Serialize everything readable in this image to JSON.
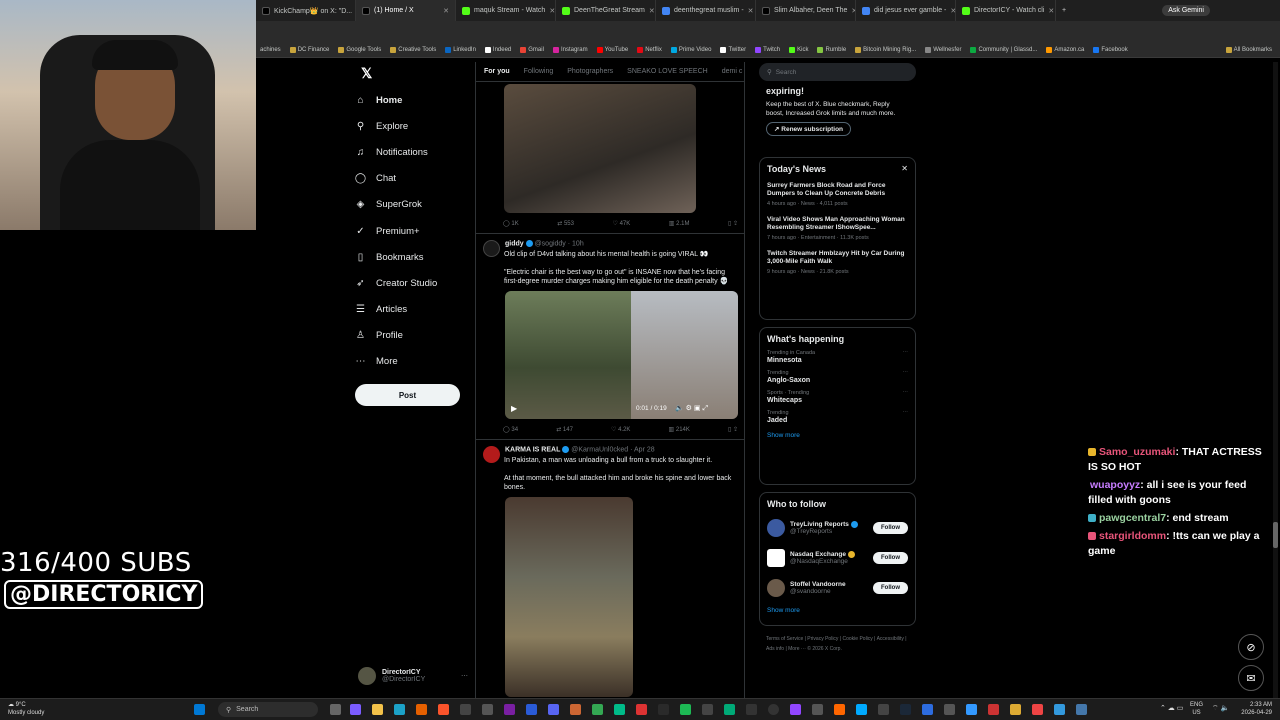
{
  "browser": {
    "tabs": [
      {
        "title": "KickChamp👑 on X: \"D...",
        "color": "#000000"
      },
      {
        "title": "(1) Home / X",
        "color": "#000000",
        "active": true
      },
      {
        "title": "maquk Stream - Watch",
        "color": "#53fc18"
      },
      {
        "title": "DeenTheGreat Stream",
        "color": "#53fc18"
      },
      {
        "title": "deenthegreat muslim -",
        "color": "#4285f4"
      },
      {
        "title": "Slim Albaher, Deen The",
        "color": "#000000"
      },
      {
        "title": "did jesus ever gamble -",
        "color": "#4285f4"
      },
      {
        "title": "DirectorICY - Watch cli",
        "color": "#53fc18"
      }
    ],
    "ask_gemini": "Ask Gemini",
    "bookmarks": [
      "achines",
      "DC Finance",
      "Google Tools",
      "Creative Tools",
      "LinkedIn",
      "Indeed",
      "Gmail",
      "Instagram",
      "YouTube",
      "Netflix",
      "Prime Video",
      "Twitter",
      "Twitch",
      "Kick",
      "Rumble",
      "Bitcoin Mining Rig...",
      "Wellnesfer",
      "Community | Glassd...",
      "Amazon.ca",
      "Facebook",
      "All Bookmarks"
    ]
  },
  "overlay": {
    "subs": "316/400 SUBS",
    "handle": "@DIRECTORICY"
  },
  "nav": {
    "items": [
      {
        "label": "Home",
        "icon": "⌂"
      },
      {
        "label": "Explore",
        "icon": "⚲"
      },
      {
        "label": "Notifications",
        "icon": "🔔"
      },
      {
        "label": "Chat",
        "icon": "◯"
      },
      {
        "label": "SuperGrok",
        "icon": "◈"
      },
      {
        "label": "Premium+",
        "icon": "✓"
      },
      {
        "label": "Bookmarks",
        "icon": "▯"
      },
      {
        "label": "Creator Studio",
        "icon": "➶"
      },
      {
        "label": "Articles",
        "icon": "☰"
      },
      {
        "label": "Profile",
        "icon": "♙"
      },
      {
        "label": "More",
        "icon": "⋯"
      }
    ],
    "post": "Post",
    "account_name": "DirectorICY",
    "account_handle": "@DirectorICY"
  },
  "timeline": {
    "tabs": [
      "For you",
      "Following",
      "Photographers",
      "SNEAKO LOVE SPEECH",
      "demi c"
    ],
    "tweet1_stats": [
      "1K",
      "553",
      "47K",
      "2.1M"
    ],
    "tweet2": {
      "name": "giddy",
      "handle": "@sogiddy · 10h",
      "text1": "Old clip of D4vd talking about his mental health is going VIRAL 👀",
      "text2": "\"Electric chair is the best way to go out\" is INSANE now that he's facing first-degree murder charges making him eligible for the death penalty 💀",
      "video_time": "0:01 / 0:19",
      "stats": [
        "34",
        "147",
        "4.2K",
        "214K"
      ]
    },
    "tweet3": {
      "name": "KARMA IS REAL",
      "handle": "@KarmaUnl0cked · Apr 28",
      "text1": "In Pakistan, a man was unloading a bull from a truck to slaughter it.",
      "text2": "At that moment, the bull attacked him and broke his spine and lower back bones."
    }
  },
  "right": {
    "search_placeholder": "Search",
    "premium": {
      "title": "expiring!",
      "body": "Keep the best of X. Blue checkmark, Reply boost, Increased Grok limits and much more.",
      "button": "Renew subscription"
    },
    "news": {
      "title": "Today's News",
      "items": [
        {
          "headline": "Surrey Farmers Block Road and Force Dumpers to Clean Up Concrete Debris",
          "meta": "4 hours ago · News · 4,011 posts"
        },
        {
          "headline": "Viral Video Shows Man Approaching Woman Resembling Streamer IShowSpee...",
          "meta": "7 hours ago · Entertainment · 11.3K posts"
        },
        {
          "headline": "Twitch Streamer Hmblzayy Hit by Car During 3,000-Mile Faith Walk",
          "meta": "9 hours ago · News · 21.8K posts"
        }
      ]
    },
    "happening": {
      "title": "What's happening",
      "trends": [
        {
          "context": "Trending in Canada",
          "name": "Minnesota"
        },
        {
          "context": "Trending",
          "name": "Anglo-Saxon"
        },
        {
          "context": "Sports · Trending",
          "name": "Whitecaps"
        },
        {
          "context": "Trending",
          "name": "Jaded"
        }
      ],
      "show_more": "Show more"
    },
    "follow": {
      "title": "Who to follow",
      "accounts": [
        {
          "name": "TreyLiving Reports",
          "handle": "@TreyReports"
        },
        {
          "name": "Nasdaq Exchange",
          "handle": "@NasdaqExchange"
        },
        {
          "name": "Stoffel Vandoorne",
          "handle": "@svandoorne"
        }
      ],
      "button": "Follow",
      "show_more": "Show more"
    },
    "footer": "Terms of Service | Privacy Policy | Cookie Policy | Accessibility | Ads info | More ··· © 2026 X Corp."
  },
  "chat": [
    {
      "user": "Samo_uzumaki",
      "color": "#e8557a",
      "badge": "#e8b62c",
      "msg": ": THAT ACTRESS IS SO HOT"
    },
    {
      "user": "wuapoyyz",
      "color": "#c77dff",
      "badge": "",
      "msg": ": all i see is your feed filled with goons"
    },
    {
      "user": "pawgcentral7",
      "color": "#9ad1a0",
      "badge": "#3fb0c7",
      "msg": ": end stream"
    },
    {
      "user": "stargirldomm",
      "color": "#e8557a",
      "badge": "#e8557a",
      "msg": ": !tts can we play a game"
    }
  ],
  "taskbar": {
    "weather_temp": "9°C",
    "weather_desc": "Mostly cloudy",
    "search": "Search",
    "lang": "ENG",
    "region": "US",
    "time": "2:33 AM",
    "date": "2026-04-29"
  }
}
